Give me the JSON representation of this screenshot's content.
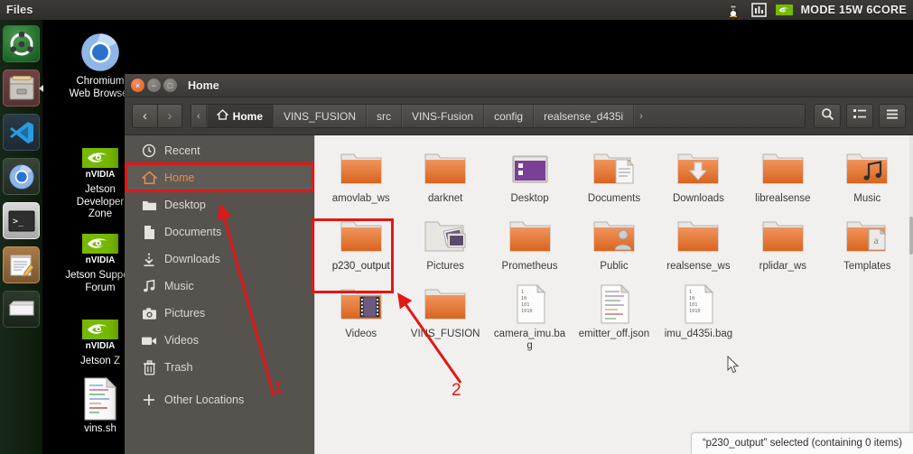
{
  "top_panel": {
    "app_title": "Files",
    "tray": {
      "icons": [
        "penguin-icon",
        "system-monitor-icon",
        "nvidia-icon"
      ],
      "power_mode": "MODE 15W 6CORE"
    }
  },
  "launcher": {
    "items": [
      {
        "name": "ubuntu-dash-icon",
        "label": "Ubuntu"
      },
      {
        "name": "files-icon",
        "label": "Files",
        "active": true
      },
      {
        "name": "vscode-icon",
        "label": "Visual Studio Code"
      },
      {
        "name": "chromium-icon",
        "label": "Chromium Web Browser"
      },
      {
        "name": "terminal-icon",
        "label": "Terminal"
      },
      {
        "name": "text-editor-icon",
        "label": "Text Editor"
      },
      {
        "name": "disk-drive-icon",
        "label": "Disks"
      }
    ]
  },
  "desktop": {
    "icons": [
      {
        "name": "chromium-web-browser",
        "label": "Chromium Web Browser",
        "icon": "chromium-icon"
      },
      {
        "name": "jetson-developer-zone",
        "label": "Jetson Developer Zone",
        "icon": "nvidia-icon"
      },
      {
        "name": "jetson-support-forum",
        "label": "Jetson Support Forum",
        "icon": "nvidia-icon"
      },
      {
        "name": "jetson-zoo",
        "label": "Jetson Z",
        "icon": "nvidia-icon"
      },
      {
        "name": "vins-script",
        "label": "vins.sh",
        "icon": "script-file-icon"
      }
    ]
  },
  "file_manager": {
    "window_title": "Home",
    "window_buttons": {
      "close": "×",
      "minimize": "−",
      "maximize": "□"
    },
    "nav": {
      "back": "‹",
      "forward": "›"
    },
    "breadcrumb": {
      "overflow": "‹",
      "items": [
        "Home",
        "VINS_FUSION",
        "src",
        "VINS-Fusion",
        "config",
        "realsense_d435i"
      ],
      "more": "›"
    },
    "toolbar_buttons": [
      {
        "name": "search-button",
        "icon": "search-icon"
      },
      {
        "name": "view-options-button",
        "icon": "list-view-icon"
      },
      {
        "name": "menu-button",
        "icon": "hamburger-menu-icon"
      }
    ],
    "sidebar": [
      {
        "label": "Recent",
        "icon": "clock-icon",
        "selected": false
      },
      {
        "label": "Home",
        "icon": "home-icon",
        "selected": true
      },
      {
        "label": "Desktop",
        "icon": "folder-icon",
        "selected": false
      },
      {
        "label": "Documents",
        "icon": "document-icon",
        "selected": false
      },
      {
        "label": "Downloads",
        "icon": "download-icon",
        "selected": false
      },
      {
        "label": "Music",
        "icon": "music-note-icon",
        "selected": false
      },
      {
        "label": "Pictures",
        "icon": "camera-icon",
        "selected": false
      },
      {
        "label": "Videos",
        "icon": "video-icon",
        "selected": false
      },
      {
        "label": "Trash",
        "icon": "trash-icon",
        "selected": false
      },
      {
        "label": "Other Locations",
        "icon": "plus-icon",
        "selected": false
      }
    ],
    "files": [
      {
        "label": "amovlab_ws",
        "type": "folder",
        "selected": false
      },
      {
        "label": "darknet",
        "type": "folder",
        "selected": false
      },
      {
        "label": "Desktop",
        "type": "folder-desktop",
        "selected": false
      },
      {
        "label": "Documents",
        "type": "folder-documents",
        "selected": false
      },
      {
        "label": "Downloads",
        "type": "folder-downloads",
        "selected": false
      },
      {
        "label": "librealsense",
        "type": "folder",
        "selected": false
      },
      {
        "label": "Music",
        "type": "folder-music",
        "selected": false
      },
      {
        "label": "p230_output",
        "type": "folder",
        "selected": true
      },
      {
        "label": "Pictures",
        "type": "folder-pictures",
        "selected": false
      },
      {
        "label": "Prometheus",
        "type": "folder",
        "selected": false
      },
      {
        "label": "Public",
        "type": "folder-public",
        "selected": false
      },
      {
        "label": "realsense_ws",
        "type": "folder",
        "selected": false
      },
      {
        "label": "rplidar_ws",
        "type": "folder",
        "selected": false
      },
      {
        "label": "Templates",
        "type": "folder-templates",
        "selected": false
      },
      {
        "label": "Videos",
        "type": "folder-videos",
        "selected": false
      },
      {
        "label": "VINS_FUSION",
        "type": "folder",
        "selected": false
      },
      {
        "label": "camera_imu.bag",
        "type": "file-binary",
        "selected": false
      },
      {
        "label": "emitter_off.json",
        "type": "file-text",
        "selected": false
      },
      {
        "label": "imu_d435i.bag",
        "type": "file-binary",
        "selected": false
      }
    ],
    "status": "“p230_output” selected  (containing 0 items)"
  },
  "annotations": {
    "color": "#e41616",
    "marks": [
      {
        "number": "1",
        "target": "sidebar-home"
      },
      {
        "number": "2",
        "target": "p230_output-folder"
      }
    ]
  }
}
